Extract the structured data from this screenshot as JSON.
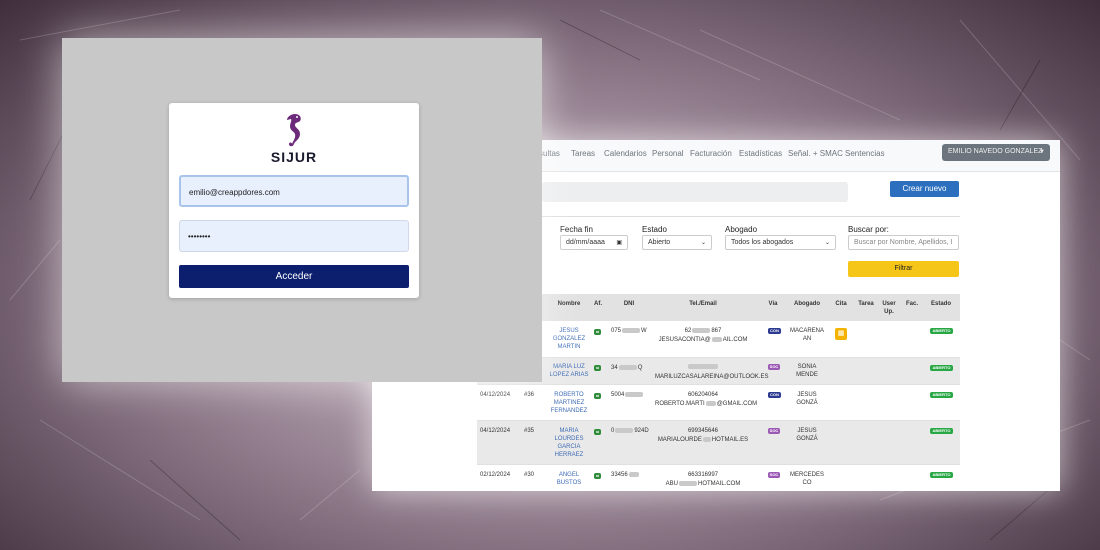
{
  "colors": {
    "login_button": "#0b1f6e",
    "primary": "#2c6fbe",
    "filter": "#f5c518",
    "estado_badge": "#28a745"
  },
  "login": {
    "brand": "SIJUR",
    "email_value": "emilio@creappdores.com",
    "password_value": "••••••••",
    "submit_label": "Acceder"
  },
  "nav": {
    "items": [
      "sultas",
      "Tareas",
      "Calendarios",
      "Personal",
      "Facturación",
      "Estadísticas",
      "Señal. + SMAC",
      "Sentencias"
    ],
    "user_label": "EMILIO NAVEDO GONZALEZ"
  },
  "toolbar": {
    "new_label": "Crear nuevo",
    "filter_label": "Filtrar"
  },
  "filters": {
    "fecha_fin_label": "Fecha fin",
    "fecha_fin_placeholder": "dd/mm/aaaa",
    "estado_label": "Estado",
    "estado_value": "Abierto",
    "abogado_label": "Abogado",
    "abogado_value": "Todos los abogados",
    "buscar_label": "Buscar por:",
    "buscar_placeholder": "Buscar por Nombre, Apellidos, I"
  },
  "table": {
    "headers": [
      "Nombre",
      "Af.",
      "DNI",
      "Tel./Email",
      "Vía",
      "Abogado",
      "Cita",
      "Tarea",
      "User Up.",
      "Fac.",
      "Estado"
    ],
    "rows": [
      {
        "fecha": "",
        "num": "",
        "nombre": "JESUS GONZALEZ MARTIN",
        "af": "sí",
        "dni": "075",
        "tel": "62",
        "tel2": "867",
        "email": "JESUSACONTIA@",
        "email2": "AIL.COM",
        "via": "CON",
        "abogado": "MACARENA AN",
        "cita": true,
        "estado": "ABIERTO"
      },
      {
        "fecha": "",
        "num": "",
        "nombre": "MARIA LUZ LOPEZ ARIAS",
        "af": "sí",
        "dni": "34",
        "dni2": "Q",
        "tel": "",
        "tel2": "",
        "email": "MARILUZCASALAREINA@OUTLOOK.ES",
        "email2": "",
        "via": "SOC",
        "abogado": "SONIA MENDE",
        "cita": false,
        "estado": "ABIERTO"
      },
      {
        "fecha": "04/12/2024",
        "num": "#36",
        "nombre": "ROBERTO MARTINEZ FERNANDEZ",
        "af": "sí",
        "dni": "5004",
        "tel": "606204064",
        "tel2": "",
        "email": "ROBERTO.MARTI",
        "email2": "@GMAIL.COM",
        "via": "CON",
        "abogado": "JESUS GONZÁ",
        "cita": false,
        "estado": "ABIERTO"
      },
      {
        "fecha": "04/12/2024",
        "num": "#35",
        "nombre": "MARIA LOURDES GARCIA HERRAEZ",
        "af": "sí",
        "dni": "0",
        "dni2": "924D",
        "tel": "699345646",
        "tel2": "",
        "email": "MARIALOURDE",
        "email2": "HOTMAIL.ES",
        "via": "SOC",
        "abogado": "JESUS GONZÁ",
        "cita": false,
        "estado": "ABIERTO"
      },
      {
        "fecha": "02/12/2024",
        "num": "#30",
        "nombre": "ANGEL BUSTOS",
        "af": "sí",
        "dni": "33456",
        "tel": "663316997",
        "tel2": "",
        "email": "ABU",
        "email2": "HOTMAIL.COM",
        "via": "SOC",
        "abogado": "MERCEDES CO",
        "cita": false,
        "estado": "ABIERTO"
      }
    ]
  }
}
